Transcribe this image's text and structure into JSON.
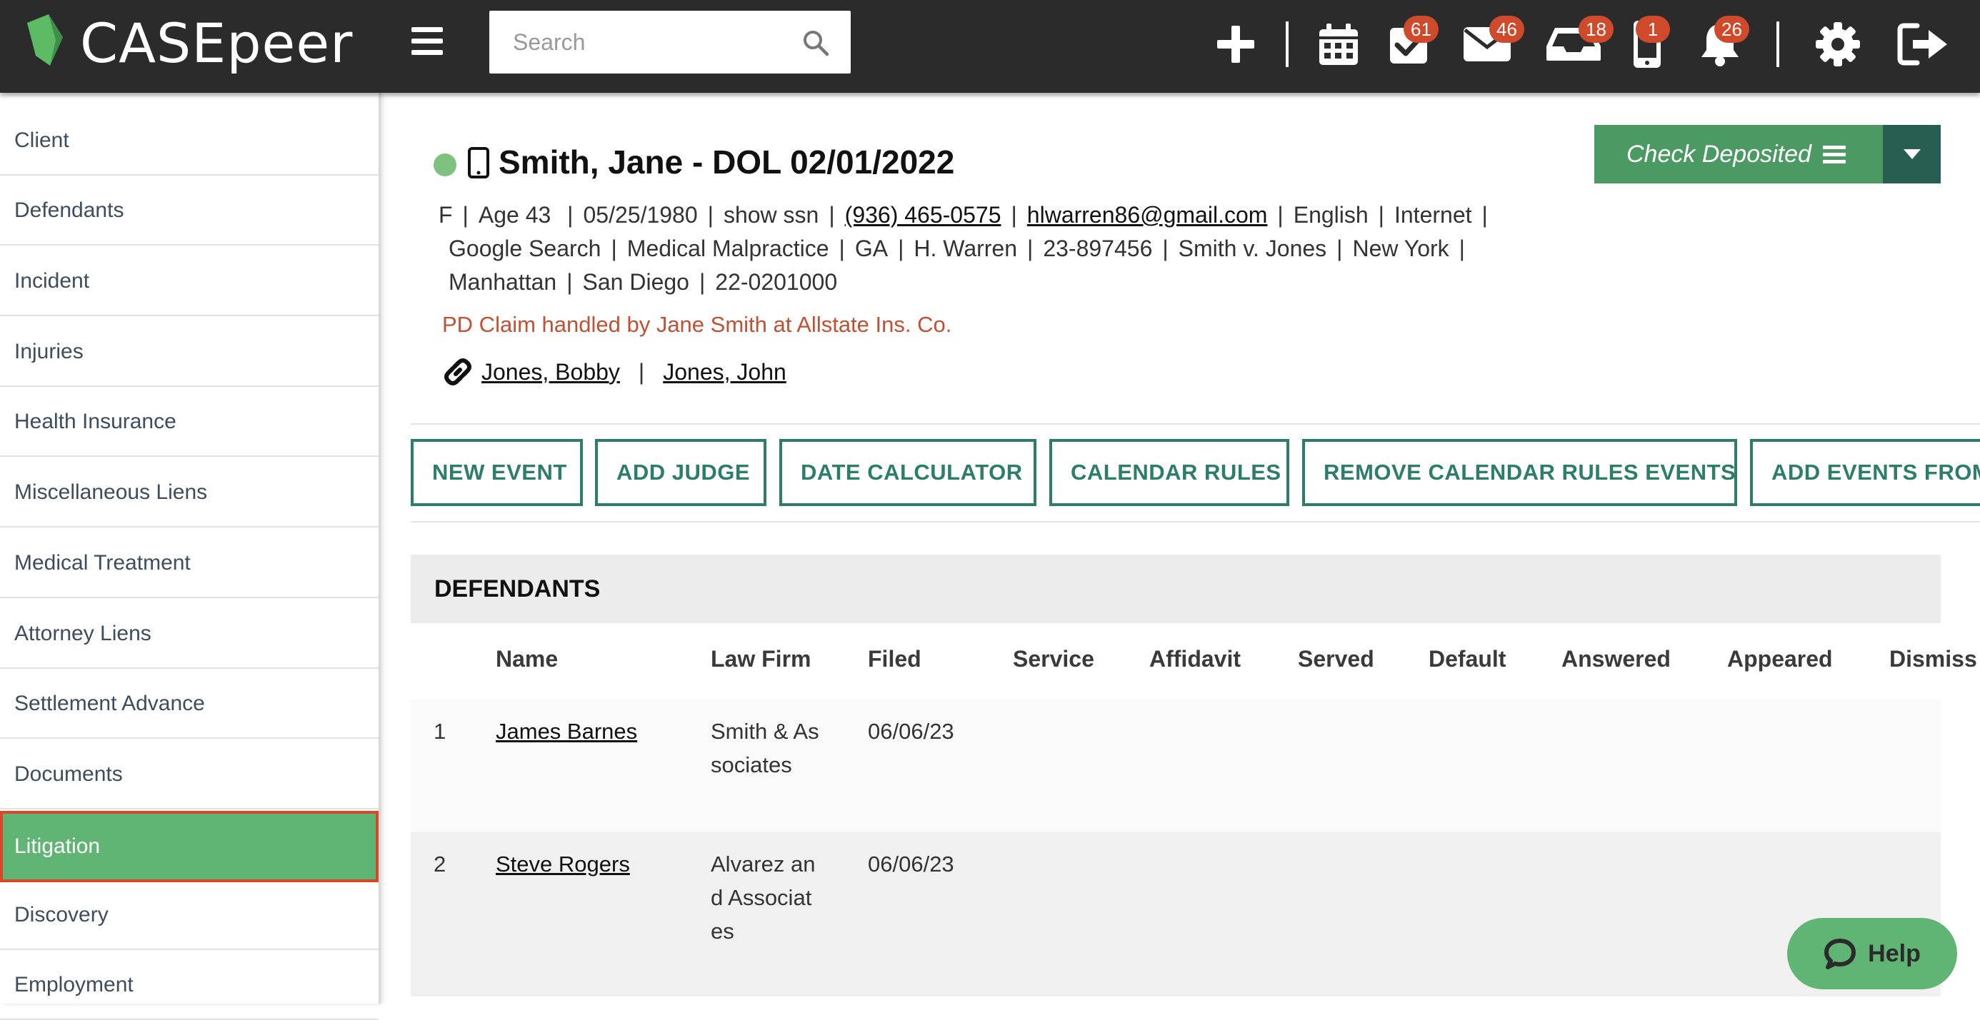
{
  "app": {
    "logo_text": "CASEpeer"
  },
  "header": {
    "search_placeholder": "Search",
    "badges": {
      "tasks": "61",
      "mail": "46",
      "inbox": "18",
      "phone": "1",
      "notifications": "26"
    }
  },
  "sidebar": {
    "items": [
      "Client",
      "Defendants",
      "Incident",
      "Injuries",
      "Health Insurance",
      "Miscellaneous Liens",
      "Medical Treatment",
      "Attorney Liens",
      "Settlement Advance",
      "Documents",
      "Litigation",
      "Discovery",
      "Employment"
    ],
    "active": "Litigation"
  },
  "case": {
    "title": "Smith, Jane - DOL 02/01/2022",
    "line1": {
      "sex": "F",
      "age": "Age 43",
      "dob": "05/25/1980",
      "ssn": "show ssn",
      "phone": "(936) 465-0575",
      "email": "hlwarren86@gmail.com",
      "language": "English",
      "source": "Internet"
    },
    "line2": {
      "referral": "Google Search",
      "case_type": "Medical Malpractice",
      "state": "GA",
      "attorney": "H. Warren",
      "case_number": "23-897456",
      "case_name": "Smith v. Jones",
      "court_state": "New York"
    },
    "line3": {
      "county": "Manhattan",
      "city": "San Diego",
      "docket": "22-0201000"
    },
    "claim_note": "PD Claim handled by Jane Smith at Allstate Ins. Co.",
    "linked": [
      "Jones, Bobby",
      "Jones, John"
    ]
  },
  "check_button": {
    "label": "Check Deposited"
  },
  "actions": [
    "NEW EVENT",
    "ADD JUDGE",
    "DATE CALCULATOR",
    "CALENDAR RULES",
    "REMOVE CALENDAR RULES EVENTS",
    "ADD EVENTS FROM"
  ],
  "defendants": {
    "title": "DEFENDANTS",
    "columns": [
      "Name",
      "Law Firm",
      "Filed",
      "Service",
      "Affidavit",
      "Served",
      "Default",
      "Answered",
      "Appeared",
      "Dismiss"
    ],
    "rows": [
      {
        "num": "1",
        "name": "James Barnes",
        "law_firm": "Smith & Associates",
        "filed": "06/06/23"
      },
      {
        "num": "2",
        "name": "Steve Rogers",
        "law_firm": "Alvarez and Associates",
        "filed": "06/06/23"
      }
    ]
  },
  "help": {
    "label": "Help"
  },
  "colors": {
    "accent_green": "#61b574",
    "button_teal": "#2d7d6b",
    "badge_red": "#cf4a2b",
    "claim_red": "#c25134",
    "active_border": "#d9472b"
  }
}
